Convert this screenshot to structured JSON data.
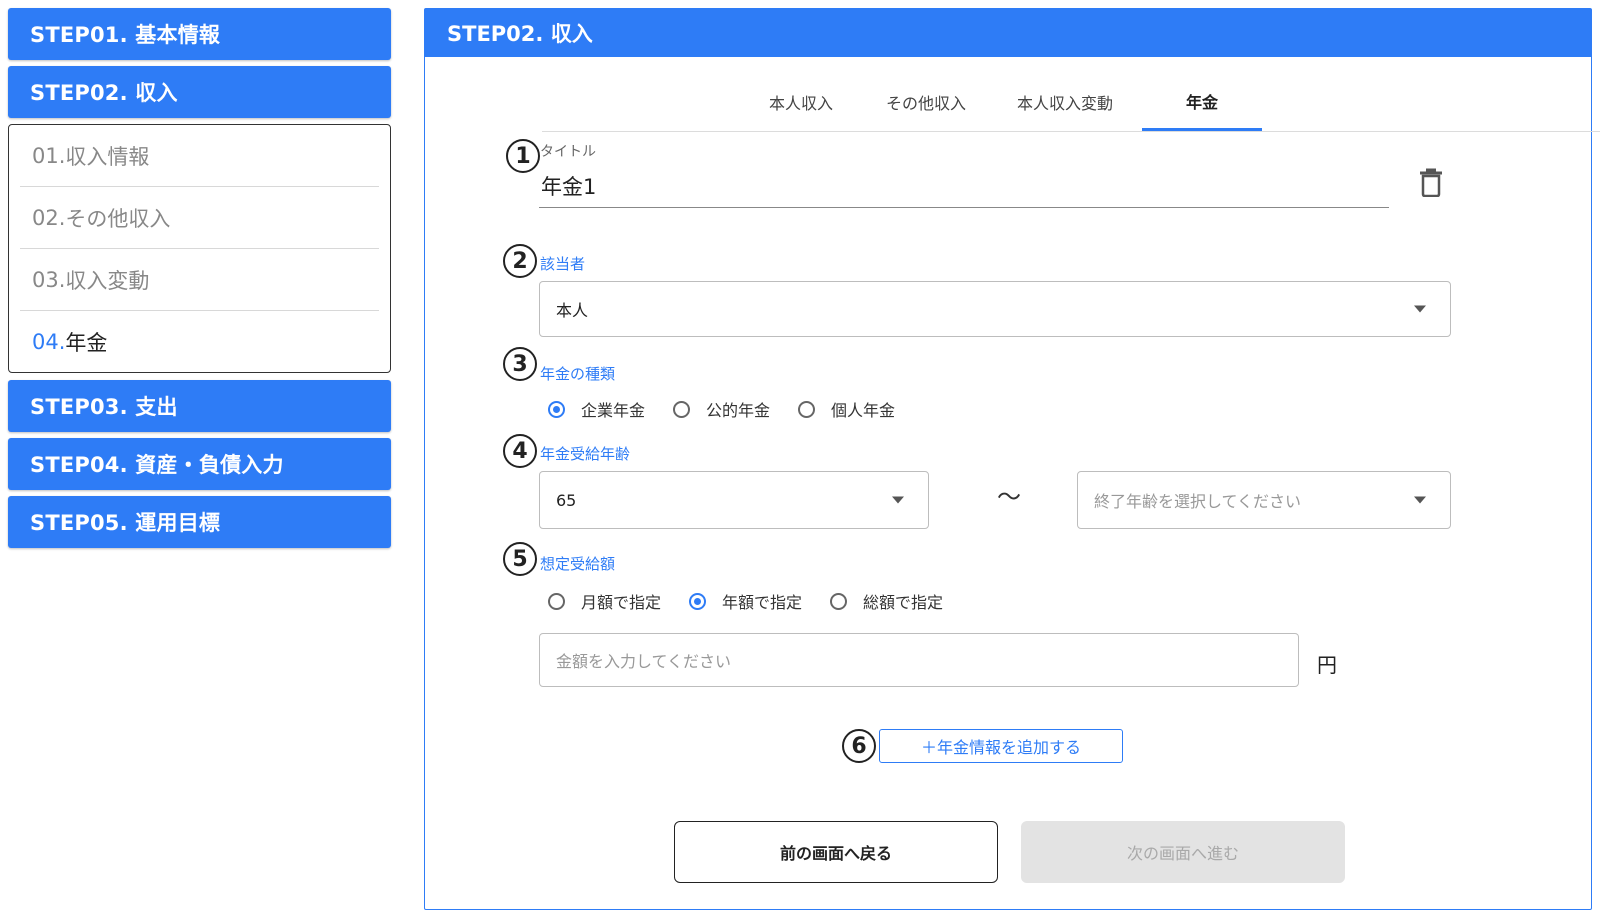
{
  "sidebar": {
    "step01": "STEP01. 基本情報",
    "step02": "STEP02. 収入",
    "substeps": [
      {
        "num": "01.",
        "label": " 収入情報"
      },
      {
        "num": "02.",
        "label": " その他収入"
      },
      {
        "num": "03.",
        "label": " 収入変動"
      },
      {
        "num": "04.",
        "label": " 年金"
      }
    ],
    "step03": "STEP03. 支出",
    "step04": "STEP04. 資産・負債入力",
    "step05": "STEP05. 運用目標"
  },
  "panel": {
    "header": "STEP02. 収入",
    "tabs": [
      "本人収入",
      "その他収入",
      "本人収入変動",
      "年金"
    ],
    "markers": [
      "1",
      "2",
      "3",
      "4",
      "5",
      "6"
    ],
    "title": {
      "label": "タイトル",
      "value": "年金1"
    },
    "beneficiary": {
      "label": "該当者",
      "value": "本人"
    },
    "pension_type": {
      "label": "年金の種類",
      "options": [
        "企業年金",
        "公的年金",
        "個人年金"
      ],
      "selected": 0
    },
    "age": {
      "label": "年金受給年齢",
      "start_value": "65",
      "separator": "〜",
      "end_placeholder": "終了年齢を選択してください"
    },
    "amount": {
      "label": "想定受給額",
      "options": [
        "月額で指定",
        "年額で指定",
        "総額で指定"
      ],
      "selected": 1,
      "placeholder": "金額を入力してください",
      "unit": "円"
    },
    "add_button": "＋年金情報を追加する",
    "back_button": "前の画面へ戻る",
    "next_button": "次の画面へ進む"
  },
  "colors": {
    "accent": "#2e7cf6",
    "disabled_bg": "#e3e3e3"
  }
}
